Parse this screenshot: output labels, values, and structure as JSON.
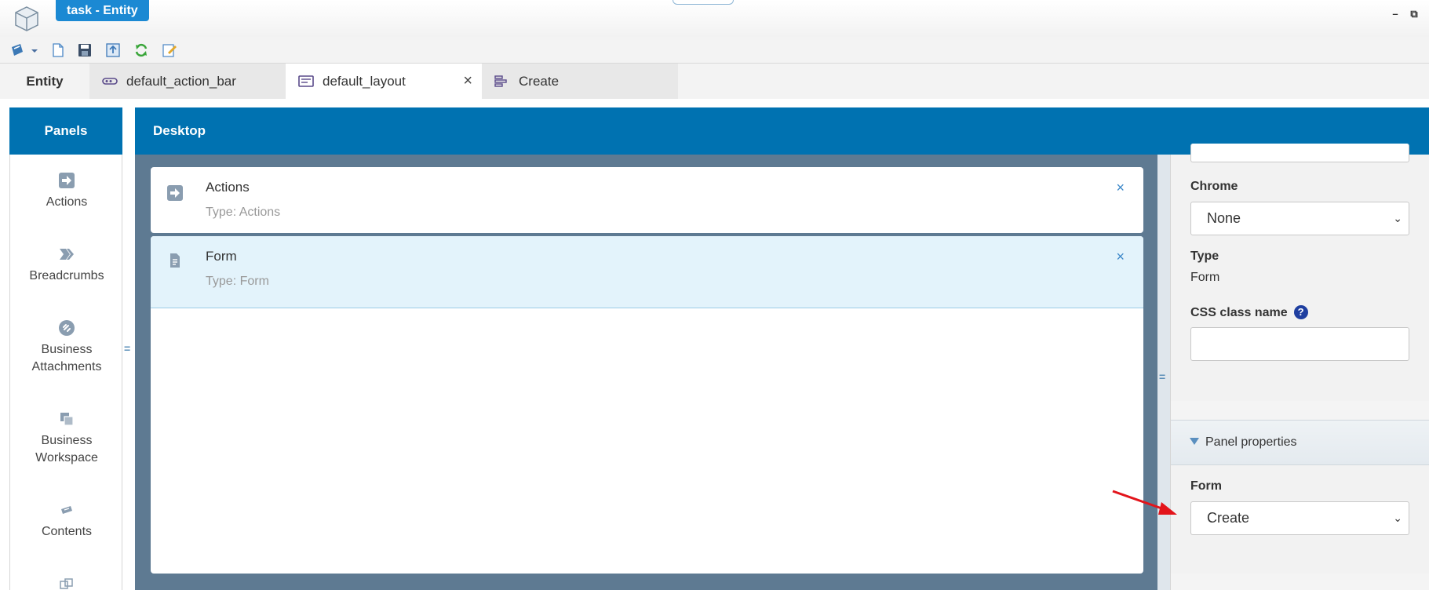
{
  "window": {
    "title": "task - Entity"
  },
  "toolbar": {
    "icons": [
      "app-menu-icon",
      "chevron-down-icon",
      "new-document-icon",
      "save-icon",
      "publish-icon",
      "refresh-icon",
      "edit-icon"
    ]
  },
  "tabs": [
    {
      "label": "Entity",
      "icon": null
    },
    {
      "label": "default_action_bar",
      "icon": "action-bar-icon"
    },
    {
      "label": "default_layout",
      "icon": "layout-icon",
      "active": true,
      "close": "×"
    },
    {
      "label": "Create",
      "icon": "form-icon"
    }
  ],
  "panels": {
    "header": "Panels",
    "items": [
      {
        "label": "Actions",
        "icon": "actions-icon"
      },
      {
        "label": "Breadcrumbs",
        "icon": "breadcrumbs-icon"
      },
      {
        "label": "Business Attachments",
        "icon": "attachment-icon"
      },
      {
        "label": "Business Workspace",
        "icon": "workspace-icon"
      },
      {
        "label": "Contents",
        "icon": "contents-icon"
      }
    ]
  },
  "desktop": {
    "header": "Desktop",
    "cards": [
      {
        "title": "Actions",
        "type": "Type: Actions",
        "close": "×",
        "selected": false
      },
      {
        "title": "Form",
        "type": "Type: Form",
        "close": "×",
        "selected": true
      }
    ]
  },
  "properties": {
    "chrome_label": "Chrome",
    "chrome_value": "None",
    "type_label": "Type",
    "type_value": "Form",
    "css_label": "CSS class name",
    "css_help": "?",
    "css_value": "",
    "panel_section": "Panel properties",
    "form_label": "Form",
    "form_value": "Create"
  },
  "colors": {
    "accent": "#0072b1",
    "title_chip": "#1b89d3",
    "canvas": "#5e7a92",
    "selected_card": "#e3f3fb",
    "annotation_arrow": "#e3141b"
  }
}
